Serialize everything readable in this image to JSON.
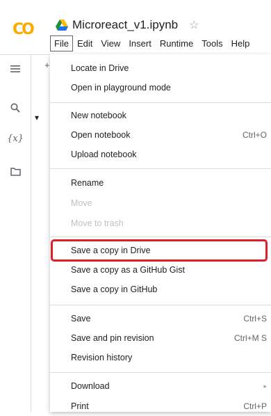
{
  "app": {
    "logo_text": "CO",
    "title": "Microreact_v1.ipynb",
    "star_icon": "star-icon",
    "drive_icon": "google-drive-icon"
  },
  "menubar": [
    "File",
    "Edit",
    "View",
    "Insert",
    "Runtime",
    "Tools",
    "Help"
  ],
  "sidebar": {
    "icons": [
      "table-of-contents-icon",
      "search-icon",
      "variables-icon",
      "folder-icon"
    ],
    "variables_label": "{x}"
  },
  "background": {
    "plus": "+",
    "arrow": "▾"
  },
  "file_menu": {
    "groups": [
      [
        {
          "label": "Locate in Drive",
          "shortcut": "",
          "disabled": false
        },
        {
          "label": "Open in playground mode",
          "shortcut": "",
          "disabled": false
        }
      ],
      [
        {
          "label": "New notebook",
          "shortcut": "",
          "disabled": false
        },
        {
          "label": "Open notebook",
          "shortcut": "Ctrl+O",
          "disabled": false
        },
        {
          "label": "Upload notebook",
          "shortcut": "",
          "disabled": false
        }
      ],
      [
        {
          "label": "Rename",
          "shortcut": "",
          "disabled": false
        },
        {
          "label": "Move",
          "shortcut": "",
          "disabled": true
        },
        {
          "label": "Move to trash",
          "shortcut": "",
          "disabled": true
        }
      ],
      [
        {
          "label": "Save a copy in Drive",
          "shortcut": "",
          "disabled": false
        },
        {
          "label": "Save a copy as a GitHub Gist",
          "shortcut": "",
          "disabled": false
        },
        {
          "label": "Save a copy in GitHub",
          "shortcut": "",
          "disabled": false
        }
      ],
      [
        {
          "label": "Save",
          "shortcut": "Ctrl+S",
          "disabled": false
        },
        {
          "label": "Save and pin revision",
          "shortcut": "Ctrl+M S",
          "disabled": false
        },
        {
          "label": "Revision history",
          "shortcut": "",
          "disabled": false
        }
      ],
      [
        {
          "label": "Download",
          "shortcut": "▸",
          "disabled": false
        },
        {
          "label": "Print",
          "shortcut": "Ctrl+P",
          "disabled": false
        }
      ]
    ],
    "highlighted": "Save a copy in Drive",
    "highlight_color": "#e01e24"
  }
}
